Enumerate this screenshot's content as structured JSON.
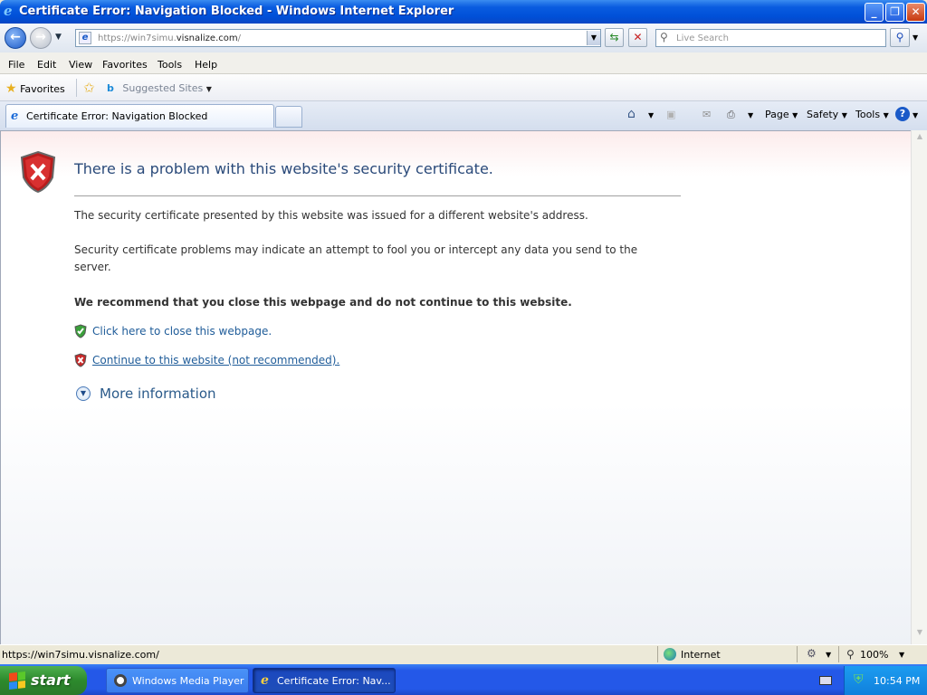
{
  "window": {
    "title": "Certificate Error: Navigation Blocked - Windows Internet Explorer"
  },
  "address_bar": {
    "url_prefix": "https://win7simu.",
    "url_domain": "visnalize.com",
    "url_suffix": "/"
  },
  "search": {
    "placeholder": "Live Search"
  },
  "menu": [
    "File",
    "Edit",
    "View",
    "Favorites",
    "Tools",
    "Help"
  ],
  "favorites_bar": {
    "favorites_label": "Favorites",
    "suggested_label": "Suggested Sites"
  },
  "tab": {
    "label": "Certificate Error: Navigation Blocked"
  },
  "command_bar": {
    "page": "Page",
    "safety": "Safety",
    "tools": "Tools"
  },
  "content": {
    "heading": "There is a problem with this website's security certificate.",
    "para1": "The security certificate presented by this website was issued for a different website's address.",
    "para2": "Security certificate problems may indicate an attempt to fool you or intercept any data you send to the server.",
    "recommend": "We recommend that you close this webpage and do not continue to this website.",
    "close_link": "Click here to close this webpage.",
    "continue_link": "Continue to this website (not recommended).",
    "more_info": "More information"
  },
  "status_bar": {
    "url": "https://win7simu.visnalize.com/",
    "zone": "Internet",
    "zoom": "100%"
  },
  "taskbar": {
    "start": "start",
    "task1": "Windows Media Player",
    "task2": "Certificate Error: Nav...",
    "clock": "10:54 PM"
  }
}
